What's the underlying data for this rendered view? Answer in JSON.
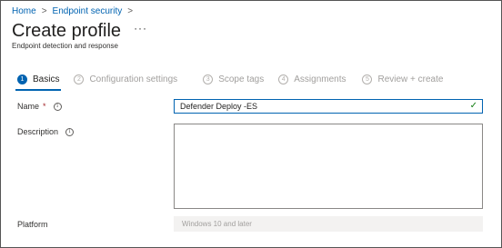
{
  "breadcrumb": {
    "items": [
      {
        "label": "Home"
      },
      {
        "label": "Endpoint security"
      }
    ],
    "separator": ">"
  },
  "header": {
    "title": "Create profile",
    "more_label": "···",
    "subtitle": "Endpoint detection and response"
  },
  "wizard": {
    "steps": [
      {
        "number": "1",
        "label": "Basics",
        "active": true
      },
      {
        "number": "2",
        "label": "Configuration settings",
        "active": false
      },
      {
        "number": "3",
        "label": "Scope tags",
        "active": false
      },
      {
        "number": "4",
        "label": "Assignments",
        "active": false
      },
      {
        "number": "5",
        "label": "Review + create",
        "active": false
      }
    ]
  },
  "form": {
    "name": {
      "label": "Name",
      "required_mark": "*",
      "info": "i",
      "value": "Defender Deploy -ES",
      "valid_mark": "✓"
    },
    "description": {
      "label": "Description",
      "info": "i",
      "value": ""
    },
    "platform": {
      "label": "Platform",
      "value": "Windows 10 and later"
    }
  },
  "colors": {
    "accent": "#0063b1",
    "success": "#107c10",
    "required": "#a4262c"
  }
}
